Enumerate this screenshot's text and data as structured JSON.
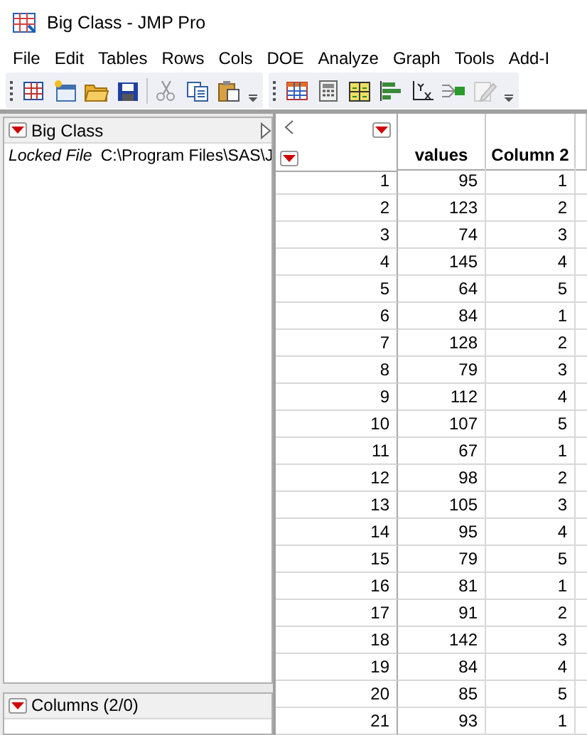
{
  "window": {
    "title": "Big Class - JMP Pro"
  },
  "menu": [
    "File",
    "Edit",
    "Tables",
    "Rows",
    "Cols",
    "DOE",
    "Analyze",
    "Graph",
    "Tools",
    "Add-I"
  ],
  "table_panel": {
    "title": "Big Class",
    "locked_label": "Locked File",
    "path": "C:\\Program Files\\SAS\\J"
  },
  "columns_panel": {
    "title": "Columns (2/0)"
  },
  "table": {
    "columns": [
      "values",
      "Column 2"
    ],
    "rows": [
      {
        "row": "1",
        "values": "95",
        "column_2": "1"
      },
      {
        "row": "2",
        "values": "123",
        "column_2": "2"
      },
      {
        "row": "3",
        "values": "74",
        "column_2": "3"
      },
      {
        "row": "4",
        "values": "145",
        "column_2": "4"
      },
      {
        "row": "5",
        "values": "64",
        "column_2": "5"
      },
      {
        "row": "6",
        "values": "84",
        "column_2": "1"
      },
      {
        "row": "7",
        "values": "128",
        "column_2": "2"
      },
      {
        "row": "8",
        "values": "79",
        "column_2": "3"
      },
      {
        "row": "9",
        "values": "112",
        "column_2": "4"
      },
      {
        "row": "10",
        "values": "107",
        "column_2": "5"
      },
      {
        "row": "11",
        "values": "67",
        "column_2": "1"
      },
      {
        "row": "12",
        "values": "98",
        "column_2": "2"
      },
      {
        "row": "13",
        "values": "105",
        "column_2": "3"
      },
      {
        "row": "14",
        "values": "95",
        "column_2": "4"
      },
      {
        "row": "15",
        "values": "79",
        "column_2": "5"
      },
      {
        "row": "16",
        "values": "81",
        "column_2": "1"
      },
      {
        "row": "17",
        "values": "91",
        "column_2": "2"
      },
      {
        "row": "18",
        "values": "142",
        "column_2": "3"
      },
      {
        "row": "19",
        "values": "84",
        "column_2": "4"
      },
      {
        "row": "20",
        "values": "85",
        "column_2": "5"
      },
      {
        "row": "21",
        "values": "93",
        "column_2": "1"
      }
    ]
  }
}
